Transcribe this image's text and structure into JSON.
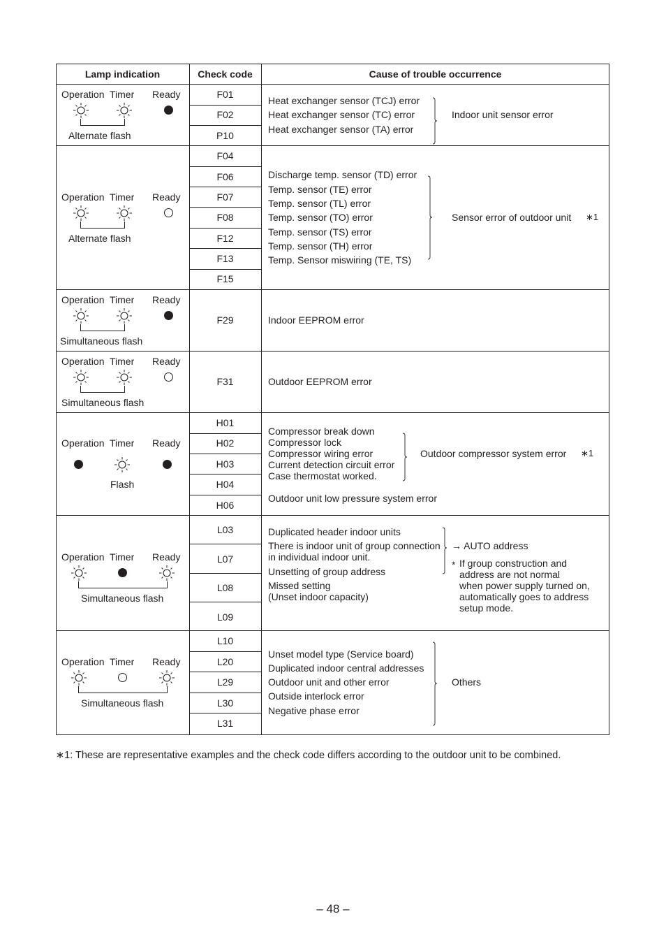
{
  "table": {
    "headers": {
      "lamp": "Lamp indication",
      "code": "Check code",
      "cause": "Cause of trouble occurrence"
    },
    "lamp_labels": {
      "operation": "Operation",
      "timer": "Timer",
      "ready": "Ready"
    },
    "groups": [
      {
        "lamps": {
          "operation": "flash",
          "timer": "flash",
          "ready": "on"
        },
        "pattern": "Alternate flash",
        "codes": [
          "F01",
          "F02",
          "P10"
        ],
        "causes": [
          "Heat exchanger sensor (TCJ) error",
          "Heat exchanger sensor (TC) error",
          "Heat exchanger sensor (TA) error"
        ],
        "summary": "Indoor unit sensor error",
        "note": ""
      },
      {
        "lamps": {
          "operation": "flash",
          "timer": "flash",
          "ready": "off"
        },
        "pattern": "Alternate flash",
        "codes": [
          "F04",
          "F06",
          "F07",
          "F08",
          "F12",
          "F13",
          "F15"
        ],
        "causes": [
          "Discharge temp. sensor (TD) error",
          "Temp. sensor (TE) error",
          "Temp. sensor (TL) error",
          "Temp. sensor (TO) error",
          "Temp. sensor (TS) error",
          "Temp. sensor (TH) error",
          "Temp. Sensor miswiring (TE, TS)"
        ],
        "summary": "Sensor error of outdoor unit",
        "note": "∗1"
      },
      {
        "lamps": {
          "operation": "flash",
          "timer": "flash",
          "ready": "on"
        },
        "pattern": "Simultaneous flash",
        "codes": [
          "F29"
        ],
        "causes": [
          "Indoor EEPROM error"
        ],
        "summary": "",
        "note": ""
      },
      {
        "lamps": {
          "operation": "flash",
          "timer": "flash",
          "ready": "off"
        },
        "pattern": "Simultaneous flash",
        "codes": [
          "F31"
        ],
        "causes": [
          "Outdoor EEPROM error"
        ],
        "summary": "",
        "note": ""
      },
      {
        "lamps": {
          "operation": "on",
          "timer": "flash",
          "ready": "on"
        },
        "pattern": "Flash",
        "codes": [
          "H01",
          "H02",
          "H03",
          "H04",
          "H06"
        ],
        "causes": [
          "Compressor break down",
          "Compressor lock",
          "Compressor wiring error",
          "Current detection circuit error",
          "Case thermostat worked."
        ],
        "summary": "Outdoor compressor system error",
        "note": "∗1",
        "extra": "Outdoor unit low pressure system error"
      },
      {
        "lamps": {
          "operation": "flash",
          "timer": "on",
          "ready": "flash"
        },
        "pattern": "Simultaneous flash",
        "codes": [
          "L03",
          "L07",
          "L08",
          "L09"
        ],
        "causes": [
          "Duplicated header indoor units",
          "There is indoor unit of group connection",
          "in individual indoor unit.",
          "Unsetting of group address",
          "Missed setting",
          "(Unset indoor capacity)"
        ],
        "summary": "→ AUTO address",
        "note_star": "*",
        "note_lines": [
          "If group construction and",
          "address are not normal",
          "when power supply turned on,",
          "automatically goes to address",
          "setup mode."
        ]
      },
      {
        "lamps": {
          "operation": "flash",
          "timer": "off",
          "ready": "flash"
        },
        "pattern": "Simultaneous flash",
        "codes": [
          "L10",
          "L20",
          "L29",
          "L30",
          "L31"
        ],
        "causes": [
          "Unset model type (Service board)",
          "Duplicated indoor central addresses",
          "Outdoor unit and other error",
          "Outside interlock error",
          "Negative phase error"
        ],
        "summary": "Others",
        "note": ""
      }
    ]
  },
  "footnote": "∗1:   These are representative examples and the check code differs according to the outdoor unit to be combined.",
  "page_number": "– 48 –"
}
